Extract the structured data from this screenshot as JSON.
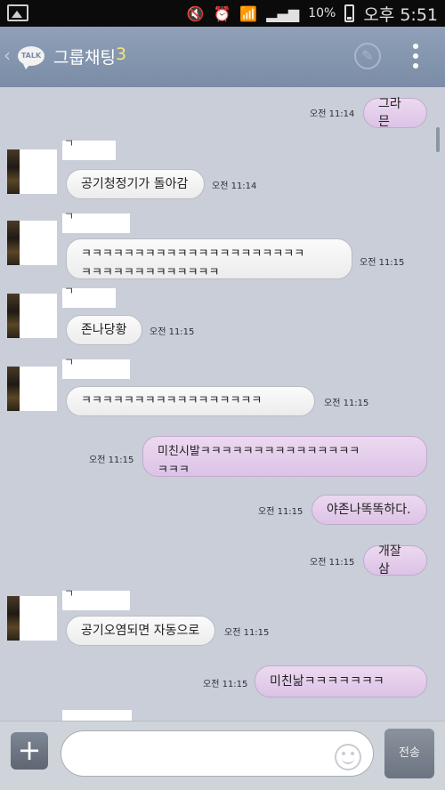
{
  "status_bar": {
    "battery": "10%",
    "time": "오후 5:51",
    "icons": [
      "gallery-icon",
      "mute-icon",
      "alarm-icon",
      "wifi-icon",
      "signal-icon",
      "battery-icon"
    ]
  },
  "header": {
    "logo": "TALK",
    "title": "그룹채팅",
    "member_count": "3"
  },
  "messages": [
    {
      "dir": "out",
      "text": "그라믄",
      "time": "오전 11:14"
    },
    {
      "dir": "in",
      "sender": "ㄱ",
      "text": "공기청정기가 돌아감",
      "time": "오전 11:14"
    },
    {
      "dir": "in",
      "sender": "ㄱ",
      "text1": "ㅋㅋㅋㅋㅋㅋㅋㅋㅋㅋㅋㅋㅋㅋㅋㅋㅋㅋㅋㅋㅋ",
      "text2": "ㅋㅋㅋㅋㅋㅋㅋㅋㅋㅋㅋㅋㅋ",
      "time": "오전 11:15"
    },
    {
      "dir": "in",
      "sender": "ㄱ",
      "text": "존나당황",
      "time": "오전 11:15"
    },
    {
      "dir": "in",
      "sender": "ㄱ",
      "text": "ㅋㅋㅋㅋㅋㅋㅋㅋㅋㅋㅋㅋㅋㅋㅋㅋㅋ",
      "time": "오전 11:15"
    },
    {
      "dir": "out",
      "text1": "미친시발ㅋㅋㅋㅋㅋㅋㅋㅋㅋㅋㅋㅋㅋㅋㅋ",
      "text2": "ㅋㅋㅋ",
      "time": "오전 11:15"
    },
    {
      "dir": "out",
      "text": "야존나똑똑하다.",
      "time": "오전 11:15"
    },
    {
      "dir": "out",
      "text": "개잘삼",
      "time": "오전 11:15"
    },
    {
      "dir": "in",
      "sender": "ㄱ",
      "text": "공기오염되면 자동으로",
      "time": "오전 11:15"
    },
    {
      "dir": "out",
      "text": "미친낢ㅋㅋㅋㅋㅋㅋㅋ",
      "time": "오전 11:15"
    }
  ],
  "input_bar": {
    "plus": "+",
    "placeholder": "",
    "send_label": "전송"
  }
}
